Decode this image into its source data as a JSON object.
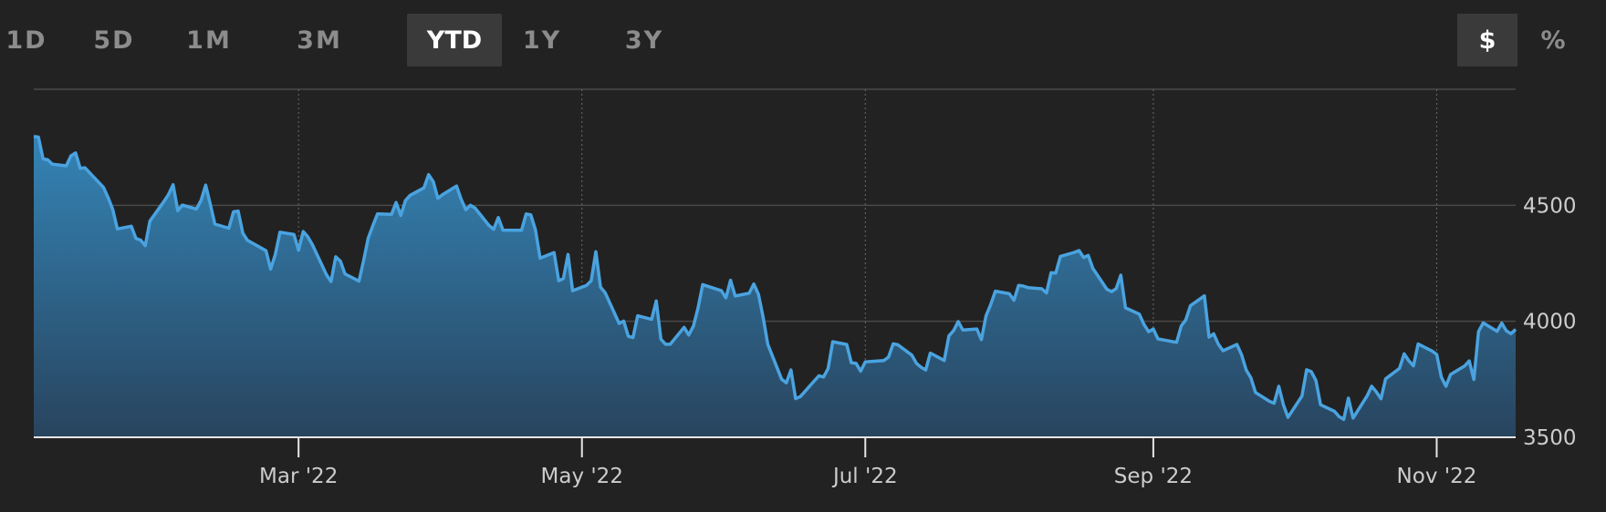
{
  "toolbar": {
    "ranges": [
      {
        "label": "1D"
      },
      {
        "label": "5D"
      },
      {
        "label": "1M"
      },
      {
        "label": "3M"
      },
      {
        "label": "YTD",
        "active": true
      },
      {
        "label": "1Y"
      },
      {
        "label": "3Y"
      }
    ],
    "units": [
      {
        "label": "$",
        "active": true
      },
      {
        "label": "%"
      }
    ]
  },
  "colors": {
    "background": "#222222",
    "line": "#4aa3e0",
    "fill_top": "#3484b6",
    "fill_bottom": "#28445e",
    "grid": "#4a4a4a",
    "baseline": "#e6e6e6"
  },
  "chart_data": {
    "type": "area",
    "x_ticks": [
      {
        "date": "2022-03-01",
        "label": "Mar '22"
      },
      {
        "date": "2022-05-01",
        "label": "May '22"
      },
      {
        "date": "2022-07-01",
        "label": "Jul '22"
      },
      {
        "date": "2022-09-01",
        "label": "Sep '22"
      },
      {
        "date": "2022-11-01",
        "label": "Nov '22"
      }
    ],
    "y_ticks": [
      3500,
      4000,
      4500
    ],
    "ylim": [
      3500,
      5000
    ],
    "xlim": [
      "2022-01-03",
      "2022-11-18"
    ],
    "grid": true,
    "y_axis_side": "right",
    "series": [
      {
        "points": [
          [
            "2022-01-03",
            4797
          ],
          [
            "2022-01-04",
            4794
          ],
          [
            "2022-01-05",
            4700
          ],
          [
            "2022-01-06",
            4696
          ],
          [
            "2022-01-07",
            4677
          ],
          [
            "2022-01-10",
            4670
          ],
          [
            "2022-01-11",
            4713
          ],
          [
            "2022-01-12",
            4726
          ],
          [
            "2022-01-13",
            4659
          ],
          [
            "2022-01-14",
            4662
          ],
          [
            "2022-01-18",
            4577
          ],
          [
            "2022-01-19",
            4533
          ],
          [
            "2022-01-20",
            4483
          ],
          [
            "2022-01-21",
            4398
          ],
          [
            "2022-01-24",
            4410
          ],
          [
            "2022-01-25",
            4357
          ],
          [
            "2022-01-26",
            4350
          ],
          [
            "2022-01-27",
            4326
          ],
          [
            "2022-01-28",
            4432
          ],
          [
            "2022-01-31",
            4516
          ],
          [
            "2022-02-01",
            4546
          ],
          [
            "2022-02-02",
            4589
          ],
          [
            "2022-02-03",
            4477
          ],
          [
            "2022-02-04",
            4501
          ],
          [
            "2022-02-07",
            4484
          ],
          [
            "2022-02-08",
            4521
          ],
          [
            "2022-02-09",
            4587
          ],
          [
            "2022-02-10",
            4504
          ],
          [
            "2022-02-11",
            4419
          ],
          [
            "2022-02-14",
            4401
          ],
          [
            "2022-02-15",
            4472
          ],
          [
            "2022-02-16",
            4475
          ],
          [
            "2022-02-17",
            4380
          ],
          [
            "2022-02-18",
            4349
          ],
          [
            "2022-02-22",
            4304
          ],
          [
            "2022-02-23",
            4225
          ],
          [
            "2022-02-24",
            4288
          ],
          [
            "2022-02-25",
            4384
          ],
          [
            "2022-02-28",
            4374
          ],
          [
            "2022-03-01",
            4306
          ],
          [
            "2022-03-02",
            4387
          ],
          [
            "2022-03-03",
            4364
          ],
          [
            "2022-03-04",
            4329
          ],
          [
            "2022-03-07",
            4201
          ],
          [
            "2022-03-08",
            4171
          ],
          [
            "2022-03-09",
            4278
          ],
          [
            "2022-03-10",
            4260
          ],
          [
            "2022-03-11",
            4204
          ],
          [
            "2022-03-14",
            4173
          ],
          [
            "2022-03-15",
            4262
          ],
          [
            "2022-03-16",
            4358
          ],
          [
            "2022-03-17",
            4412
          ],
          [
            "2022-03-18",
            4463
          ],
          [
            "2022-03-21",
            4461
          ],
          [
            "2022-03-22",
            4512
          ],
          [
            "2022-03-23",
            4456
          ],
          [
            "2022-03-24",
            4520
          ],
          [
            "2022-03-25",
            4543
          ],
          [
            "2022-03-28",
            4575
          ],
          [
            "2022-03-29",
            4632
          ],
          [
            "2022-03-30",
            4602
          ],
          [
            "2022-03-31",
            4530
          ],
          [
            "2022-04-01",
            4546
          ],
          [
            "2022-04-04",
            4583
          ],
          [
            "2022-04-05",
            4526
          ],
          [
            "2022-04-06",
            4481
          ],
          [
            "2022-04-07",
            4500
          ],
          [
            "2022-04-08",
            4488
          ],
          [
            "2022-04-11",
            4413
          ],
          [
            "2022-04-12",
            4397
          ],
          [
            "2022-04-13",
            4447
          ],
          [
            "2022-04-14",
            4393
          ],
          [
            "2022-04-18",
            4392
          ],
          [
            "2022-04-19",
            4463
          ],
          [
            "2022-04-20",
            4459
          ],
          [
            "2022-04-21",
            4394
          ],
          [
            "2022-04-22",
            4272
          ],
          [
            "2022-04-25",
            4296
          ],
          [
            "2022-04-26",
            4175
          ],
          [
            "2022-04-27",
            4184
          ],
          [
            "2022-04-28",
            4288
          ],
          [
            "2022-04-29",
            4132
          ],
          [
            "2022-05-02",
            4155
          ],
          [
            "2022-05-03",
            4175
          ],
          [
            "2022-05-04",
            4300
          ],
          [
            "2022-05-05",
            4147
          ],
          [
            "2022-05-06",
            4123
          ],
          [
            "2022-05-09",
            3991
          ],
          [
            "2022-05-10",
            4001
          ],
          [
            "2022-05-11",
            3935
          ],
          [
            "2022-05-12",
            3930
          ],
          [
            "2022-05-13",
            4024
          ],
          [
            "2022-05-16",
            4008
          ],
          [
            "2022-05-17",
            4088
          ],
          [
            "2022-05-18",
            3923
          ],
          [
            "2022-05-19",
            3901
          ],
          [
            "2022-05-20",
            3901
          ],
          [
            "2022-05-23",
            3974
          ],
          [
            "2022-05-24",
            3941
          ],
          [
            "2022-05-25",
            3979
          ],
          [
            "2022-05-26",
            4058
          ],
          [
            "2022-05-27",
            4158
          ],
          [
            "2022-05-31",
            4132
          ],
          [
            "2022-06-01",
            4101
          ],
          [
            "2022-06-02",
            4177
          ],
          [
            "2022-06-03",
            4109
          ],
          [
            "2022-06-06",
            4121
          ],
          [
            "2022-06-07",
            4161
          ],
          [
            "2022-06-08",
            4116
          ],
          [
            "2022-06-09",
            4018
          ],
          [
            "2022-06-10",
            3901
          ],
          [
            "2022-06-13",
            3750
          ],
          [
            "2022-06-14",
            3735
          ],
          [
            "2022-06-15",
            3790
          ],
          [
            "2022-06-16",
            3667
          ],
          [
            "2022-06-17",
            3675
          ],
          [
            "2022-06-21",
            3765
          ],
          [
            "2022-06-22",
            3760
          ],
          [
            "2022-06-23",
            3796
          ],
          [
            "2022-06-24",
            3912
          ],
          [
            "2022-06-27",
            3900
          ],
          [
            "2022-06-28",
            3821
          ],
          [
            "2022-06-29",
            3819
          ],
          [
            "2022-06-30",
            3785
          ],
          [
            "2022-07-01",
            3825
          ],
          [
            "2022-07-05",
            3831
          ],
          [
            "2022-07-06",
            3845
          ],
          [
            "2022-07-07",
            3903
          ],
          [
            "2022-07-08",
            3899
          ],
          [
            "2022-07-11",
            3854
          ],
          [
            "2022-07-12",
            3819
          ],
          [
            "2022-07-13",
            3802
          ],
          [
            "2022-07-14",
            3790
          ],
          [
            "2022-07-15",
            3863
          ],
          [
            "2022-07-18",
            3831
          ],
          [
            "2022-07-19",
            3937
          ],
          [
            "2022-07-20",
            3960
          ],
          [
            "2022-07-21",
            3999
          ],
          [
            "2022-07-22",
            3962
          ],
          [
            "2022-07-25",
            3967
          ],
          [
            "2022-07-26",
            3921
          ],
          [
            "2022-07-27",
            4024
          ],
          [
            "2022-07-28",
            4072
          ],
          [
            "2022-07-29",
            4130
          ],
          [
            "2022-08-01",
            4119
          ],
          [
            "2022-08-02",
            4091
          ],
          [
            "2022-08-03",
            4155
          ],
          [
            "2022-08-04",
            4152
          ],
          [
            "2022-08-05",
            4145
          ],
          [
            "2022-08-08",
            4140
          ],
          [
            "2022-08-09",
            4122
          ],
          [
            "2022-08-10",
            4210
          ],
          [
            "2022-08-11",
            4208
          ],
          [
            "2022-08-12",
            4280
          ],
          [
            "2022-08-15",
            4297
          ],
          [
            "2022-08-16",
            4305
          ],
          [
            "2022-08-17",
            4275
          ],
          [
            "2022-08-18",
            4284
          ],
          [
            "2022-08-19",
            4228
          ],
          [
            "2022-08-22",
            4138
          ],
          [
            "2022-08-23",
            4128
          ],
          [
            "2022-08-24",
            4141
          ],
          [
            "2022-08-25",
            4199
          ],
          [
            "2022-08-26",
            4058
          ],
          [
            "2022-08-29",
            4031
          ],
          [
            "2022-08-30",
            3986
          ],
          [
            "2022-08-31",
            3955
          ],
          [
            "2022-09-01",
            3967
          ],
          [
            "2022-09-02",
            3924
          ],
          [
            "2022-09-06",
            3909
          ],
          [
            "2022-09-07",
            3980
          ],
          [
            "2022-09-08",
            4006
          ],
          [
            "2022-09-09",
            4067
          ],
          [
            "2022-09-12",
            4110
          ],
          [
            "2022-09-13",
            3932
          ],
          [
            "2022-09-14",
            3946
          ],
          [
            "2022-09-15",
            3901
          ],
          [
            "2022-09-16",
            3873
          ],
          [
            "2022-09-19",
            3900
          ],
          [
            "2022-09-20",
            3856
          ],
          [
            "2022-09-21",
            3790
          ],
          [
            "2022-09-22",
            3757
          ],
          [
            "2022-09-23",
            3693
          ],
          [
            "2022-09-26",
            3655
          ],
          [
            "2022-09-27",
            3647
          ],
          [
            "2022-09-28",
            3720
          ],
          [
            "2022-09-29",
            3640
          ],
          [
            "2022-09-30",
            3586
          ],
          [
            "2022-10-03",
            3678
          ],
          [
            "2022-10-04",
            3791
          ],
          [
            "2022-10-05",
            3783
          ],
          [
            "2022-10-06",
            3745
          ],
          [
            "2022-10-07",
            3640
          ],
          [
            "2022-10-10",
            3612
          ],
          [
            "2022-10-11",
            3589
          ],
          [
            "2022-10-12",
            3577
          ],
          [
            "2022-10-13",
            3669
          ],
          [
            "2022-10-14",
            3583
          ],
          [
            "2022-10-17",
            3678
          ],
          [
            "2022-10-18",
            3720
          ],
          [
            "2022-10-19",
            3696
          ],
          [
            "2022-10-20",
            3666
          ],
          [
            "2022-10-21",
            3752
          ],
          [
            "2022-10-24",
            3797
          ],
          [
            "2022-10-25",
            3860
          ],
          [
            "2022-10-26",
            3830
          ],
          [
            "2022-10-27",
            3808
          ],
          [
            "2022-10-28",
            3902
          ],
          [
            "2022-10-31",
            3872
          ],
          [
            "2022-11-01",
            3857
          ],
          [
            "2022-11-02",
            3760
          ],
          [
            "2022-11-03",
            3720
          ],
          [
            "2022-11-04",
            3771
          ],
          [
            "2022-11-07",
            3807
          ],
          [
            "2022-11-08",
            3829
          ],
          [
            "2022-11-09",
            3749
          ],
          [
            "2022-11-10",
            3956
          ],
          [
            "2022-11-11",
            3993
          ],
          [
            "2022-11-14",
            3957
          ],
          [
            "2022-11-15",
            3992
          ],
          [
            "2022-11-16",
            3959
          ],
          [
            "2022-11-17",
            3947
          ],
          [
            "2022-11-18",
            3965
          ],
          [
            "2022-11-21",
            3950
          ]
        ]
      }
    ]
  }
}
